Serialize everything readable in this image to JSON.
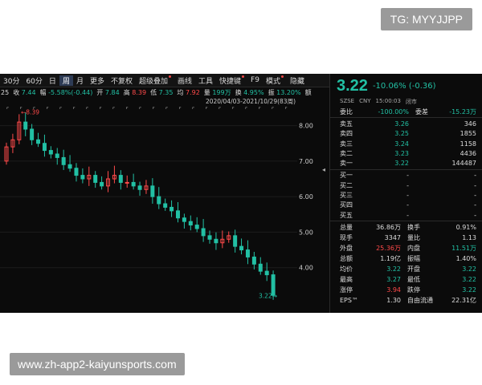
{
  "watermark_top": "TG: MYYJJPP",
  "watermark_bottom": "www.zh-app2-kaiyunsports.com",
  "toolbar": {
    "tabs": [
      "30分",
      "60分",
      "日",
      "周",
      "月",
      "更多",
      "不复权",
      "超级叠加",
      "画线",
      "工具",
      "快捷键",
      "F9",
      "模式",
      "隐藏"
    ],
    "active_tab": "周"
  },
  "stats": [
    {
      "k": "25",
      "v": ""
    },
    {
      "k": "收",
      "v": "7.44"
    },
    {
      "k": "幅",
      "v": "-5.58%(-0.44)"
    },
    {
      "k": "开",
      "v": "7.84"
    },
    {
      "k": "高",
      "v": "8.39"
    },
    {
      "k": "低",
      "v": "7.35"
    },
    {
      "k": "均",
      "v": "7.92"
    },
    {
      "k": "量",
      "v": "199万"
    },
    {
      "k": "换",
      "v": "4.95%"
    },
    {
      "k": "振",
      "v": "13.20%"
    },
    {
      "k": "额",
      "v": ""
    }
  ],
  "chart": {
    "date_range": "2020/04/03-2021/10/29(83周)",
    "y_ticks": [
      "8.00",
      "7.00",
      "6.00",
      "5.00",
      "4.00"
    ],
    "high_label": "8.39",
    "low_label": "3.22"
  },
  "chart_data": {
    "type": "candlestick",
    "y_ticks": [
      8.0,
      7.0,
      6.0,
      5.0,
      4.0
    ],
    "high": 8.39,
    "last": 3.22,
    "x_range": "2020/04/03-2021/10/29",
    "periods": 83,
    "ohlc_close_trend": [
      7.4,
      7.6,
      8.1,
      7.9,
      7.6,
      7.5,
      7.3,
      7.2,
      7.1,
      6.9,
      6.8,
      6.6,
      6.5,
      6.6,
      6.4,
      6.3,
      6.5,
      6.6,
      6.4,
      6.4,
      6.3,
      6.2,
      6.3,
      6.0,
      5.8,
      5.7,
      5.6,
      5.4,
      5.3,
      5.2,
      5.1,
      4.9,
      4.8,
      4.7,
      4.8,
      4.9,
      4.6,
      4.5,
      4.3,
      4.1,
      3.9,
      3.8,
      3.22
    ]
  },
  "quote": {
    "price": "3.22",
    "change": "-10.06% (-0.36)",
    "market": "SZSE",
    "currency": "CNY",
    "time": "15:00:03",
    "status": "闭市",
    "weibi_label": "委比",
    "weibi_val": "-100.00%",
    "weicha_label": "委差",
    "weicha_val": "-15.23万",
    "sells": [
      {
        "label": "卖五",
        "price": "3.26",
        "vol": "346"
      },
      {
        "label": "卖四",
        "price": "3.25",
        "vol": "1855"
      },
      {
        "label": "卖三",
        "price": "3.24",
        "vol": "1158"
      },
      {
        "label": "卖二",
        "price": "3.23",
        "vol": "4436"
      },
      {
        "label": "卖一",
        "price": "3.22",
        "vol": "144487"
      }
    ],
    "buys": [
      {
        "label": "买一",
        "price": "-",
        "vol": "-"
      },
      {
        "label": "买二",
        "price": "-",
        "vol": "-"
      },
      {
        "label": "买三",
        "price": "-",
        "vol": "-"
      },
      {
        "label": "买四",
        "price": "-",
        "vol": "-"
      },
      {
        "label": "买五",
        "price": "-",
        "vol": "-"
      }
    ],
    "stats": [
      {
        "l1": "总量",
        "v1": "36.86万",
        "l2": "换手",
        "v2": "0.91%",
        "c1": "",
        "c2": ""
      },
      {
        "l1": "现手",
        "v1": "3347",
        "l2": "量比",
        "v2": "1.13",
        "c1": "",
        "c2": ""
      },
      {
        "l1": "外盘",
        "v1": "25.36万",
        "l2": "内盘",
        "v2": "11.51万",
        "c1": "#ff4a4a",
        "c2": "#22c0a4"
      },
      {
        "l1": "总额",
        "v1": "1.19亿",
        "l2": "振幅",
        "v2": "1.40%",
        "c1": "",
        "c2": ""
      },
      {
        "l1": "均价",
        "v1": "3.22",
        "l2": "开盘",
        "v2": "3.22",
        "c1": "#22c0a4",
        "c2": "#22c0a4"
      },
      {
        "l1": "最高",
        "v1": "3.27",
        "l2": "最低",
        "v2": "3.22",
        "c1": "#22c0a4",
        "c2": "#22c0a4"
      },
      {
        "l1": "涨停",
        "v1": "3.94",
        "l2": "跌停",
        "v2": "3.22",
        "c1": "#ff4a4a",
        "c2": "#22c0a4"
      },
      {
        "l1": "EPS™",
        "v1": "1.30",
        "l2": "自由流通",
        "v2": "22.31亿",
        "c1": "",
        "c2": ""
      }
    ]
  },
  "colors": {
    "up": "#ff4a4a",
    "down": "#22c0a4",
    "bg": "#0b0b0b"
  }
}
